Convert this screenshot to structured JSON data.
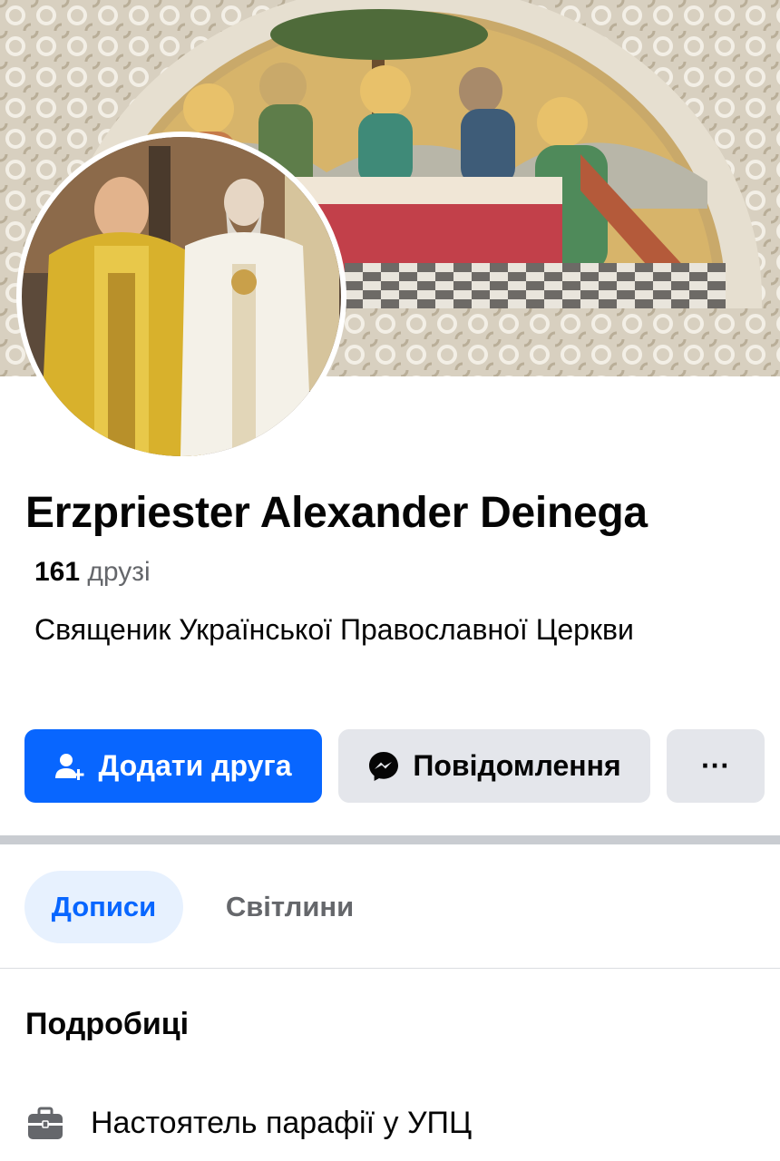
{
  "profile": {
    "name": "Erzpriester Alexander Deinega",
    "friends_count": "161",
    "friends_label": "друзі",
    "bio": "Священик Української Православної Церкви"
  },
  "actions": {
    "add_friend_label": "Додати друга",
    "message_label": "Повідомлення",
    "more_label": "···"
  },
  "tabs": [
    {
      "label": "Дописи",
      "active": true
    },
    {
      "label": "Світлини",
      "active": false
    }
  ],
  "details": {
    "title": "Подробиці",
    "items": [
      {
        "icon": "briefcase-icon",
        "text": "Настоятель парафії у УПЦ"
      }
    ]
  },
  "colors": {
    "primary": "#0866ff",
    "secondary_button": "#e4e6eb",
    "active_tab_bg": "#e7f1fe",
    "muted_text": "#65676b"
  }
}
